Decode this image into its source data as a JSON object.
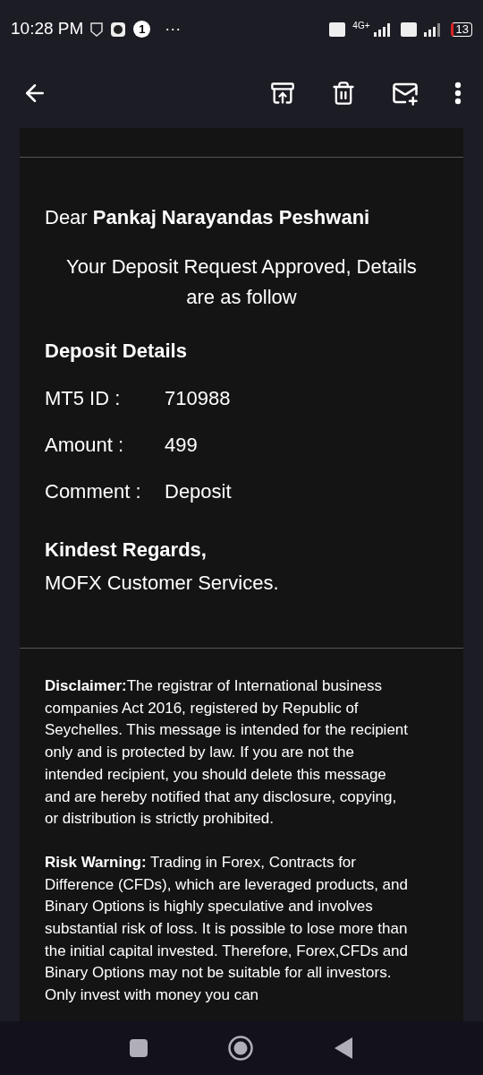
{
  "status_bar": {
    "time": "10:28 PM",
    "notification_count": "1",
    "overflow": "···",
    "network": "4G+",
    "battery": "13"
  },
  "greeting": {
    "salutation": "Dear",
    "name": "Pankaj Narayandas Peshwani"
  },
  "intro": "Your Deposit Request Approved, Details are as follow",
  "details": {
    "heading": "Deposit Details",
    "rows": [
      {
        "label": "MT5 ID :",
        "value": "710988"
      },
      {
        "label": "Amount :",
        "value": "499"
      },
      {
        "label": "Comment :",
        "value": "Deposit"
      }
    ]
  },
  "signoff": {
    "regards": "Kindest Regards,",
    "team": "MOFX Customer Services."
  },
  "notices": [
    {
      "title": "Disclaimer:",
      "text": "The registrar of International business companies Act 2016, registered by Republic of Seychelles. This message is intended for the recipient only and is protected by law. If you are not the intended recipient, you should delete this message and are hereby notified that any disclosure, copying, or distribution is strictly prohibited."
    },
    {
      "title": "Risk Warning:",
      "text": " Trading in Forex, Contracts for Difference (CFDs), which are leveraged products, and Binary Options is highly speculative and involves substantial risk of loss. It is possible to lose more than the initial capital invested. Therefore, Forex,CFDs and Binary Options may not be suitable for all investors. Only invest with money you can"
    }
  ]
}
